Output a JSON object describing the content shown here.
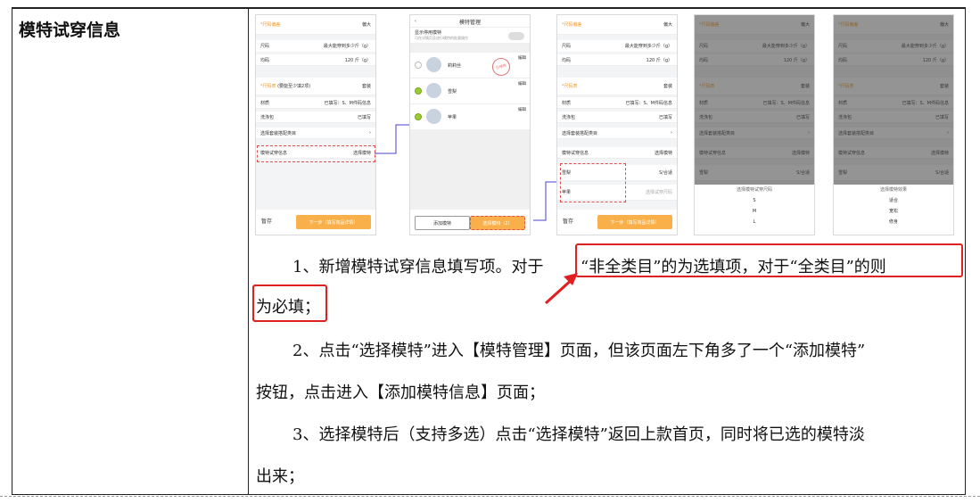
{
  "row_label": "模特试穿信息",
  "screens": {
    "s1": {
      "size_header": "*尺码偏差",
      "size_header_value": "偏大",
      "height_label": "尺码",
      "height_value": "最大能穿到多少斤（g）",
      "weight_label": "均码",
      "weight_value": "120 斤（g）",
      "set_header": "*尺码表",
      "set_sub": "(要能至少填2项)",
      "set_value": "套装",
      "material_label": "材质",
      "material_value": "已填写：S、M件码信息",
      "laundry_label": "洗涤包",
      "laundry_value": "已填写",
      "choose_label": "选择套装搭配类目",
      "model_label": "模特试穿信息",
      "model_value": "选择模特",
      "save": "暂存",
      "next": "下一步（填写商品详情）"
    },
    "s2": {
      "title": "模特管理",
      "show_disabled": "显示停用模特",
      "show_sub": "可在详情页及进行模特的批量操作",
      "stamp": "已停用",
      "edit": "编辑",
      "items": [
        "莉莉丝",
        "雪梨",
        "苹果"
      ],
      "add_btn": "添加模特",
      "select_btn": "选择模特（2）"
    },
    "s3": {
      "model_label": "模特试穿信息",
      "model_value": "选择模特",
      "model1": "雪梨",
      "model1_value": "S/合适",
      "model2": "苹果",
      "model2_value": "选择试穿尺码"
    },
    "s4": {
      "sheet_title": "选择模特试穿尺码",
      "options": [
        "S",
        "M",
        "L"
      ]
    },
    "s5": {
      "sheet_title": "选择模特效果",
      "options": [
        "适合",
        "宽松",
        "修身"
      ]
    }
  },
  "paragraphs": {
    "p1_line1_a": "1、新增模特试穿信息填写项。对于",
    "p1_line1_b": "“非全类目”的为选填项，对于“全类目”的则",
    "p1_line2": "为必填；",
    "p2_line1": "2、点击“选择模特”进入【模特管理】页面，但该页面左下角多了一个“添加模特”",
    "p2_line2": "按钮，点击进入【添加模特信息】页面；",
    "p3_line1": "3、选择模特后（支持多选）点击“选择模特”返回上款首页，同时将已选的模特淡",
    "p3_line2": "出来；"
  },
  "colors": {
    "accent": "#f59a23",
    "highlight": "#e02020",
    "link": "#4b3fd1"
  }
}
